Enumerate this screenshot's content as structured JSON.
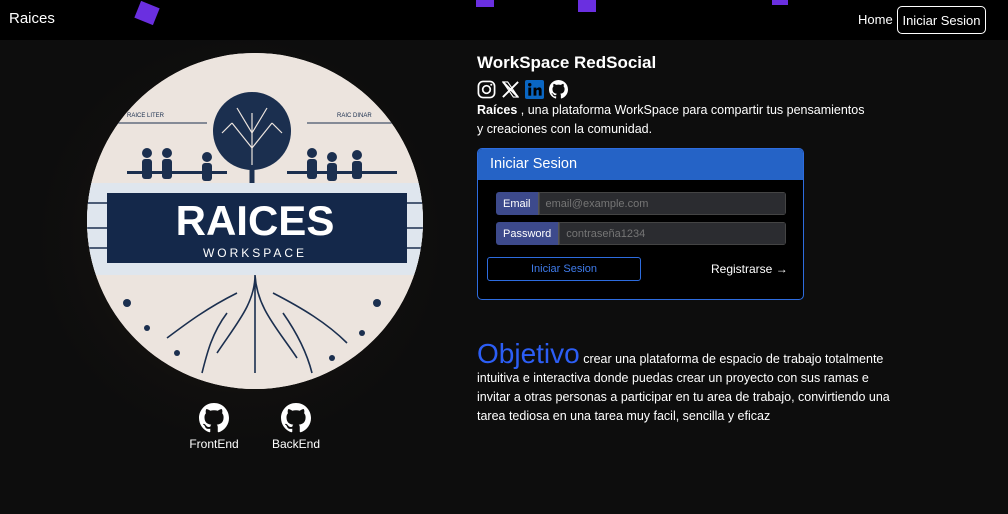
{
  "navbar": {
    "brand": "Raices",
    "home": "Home",
    "login": "Iniciar Sesion"
  },
  "logo": {
    "title": "RAICES",
    "subtitle": "WORKSPACE",
    "banner_left": "RAICE LITER",
    "banner_right": "RAIC DINAR"
  },
  "repos": [
    {
      "label": "FrontEnd",
      "icon": "github-icon"
    },
    {
      "label": "BackEnd",
      "icon": "github-icon"
    }
  ],
  "main": {
    "title": "WorkSpace RedSocial",
    "socials": [
      "instagram-icon",
      "x-icon",
      "linkedin-icon",
      "github-icon"
    ],
    "intro_bold": "Raíces",
    "intro_rest": " , una plataforma WorkSpace para compartir tus pensamientos y creaciones con la comunidad."
  },
  "login_card": {
    "header": "Iniciar Sesion",
    "email_label": "Email",
    "email_placeholder": "email@example.com",
    "password_label": "Password",
    "password_placeholder": "contraseña1234",
    "submit": "Iniciar Sesion",
    "register": "Registrarse →"
  },
  "objective": {
    "heading": "Objetivo",
    "text": " crear una plataforma de espacio de trabajo totalmente intuitiva e interactiva donde puedas crear un proyecto con sus ramas e invitar a otras personas a participar en tu area de trabajo, convirtiendo una tarea tediosa en una tarea muy facil, sencilla y eficaz"
  },
  "colors": {
    "accent": "#2563c6",
    "objective_heading": "#2c5ef5",
    "decoration": "#6a2fe0"
  }
}
